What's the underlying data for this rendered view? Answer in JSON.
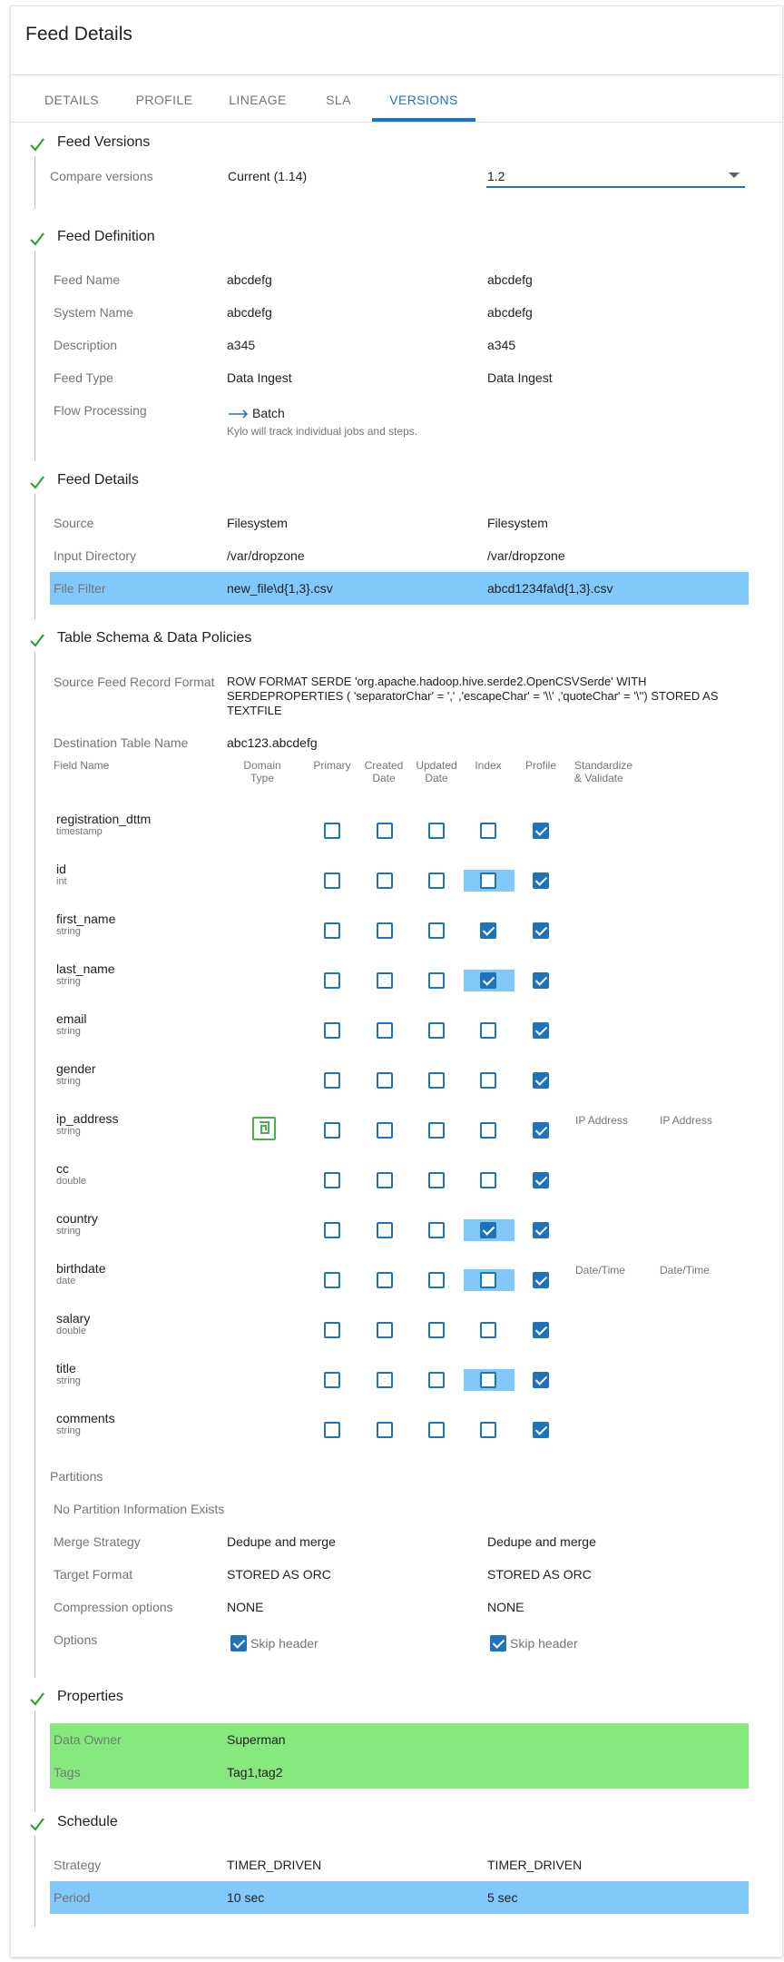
{
  "page": {
    "title": "Feed Details"
  },
  "tabs": [
    {
      "label": "DETAILS",
      "active": false
    },
    {
      "label": "PROFILE",
      "active": false
    },
    {
      "label": "LINEAGE",
      "active": false
    },
    {
      "label": "SLA",
      "active": false
    },
    {
      "label": "VERSIONS",
      "active": true
    }
  ],
  "colors": {
    "accent": "#1e73bb",
    "step_check": "#2e9f3a",
    "diff_highlight": "#81c8fb",
    "added_highlight": "#85e97e"
  },
  "versions": {
    "title": "Feed Versions",
    "compare_label": "Compare versions",
    "current": "Current (1.14)",
    "selected": "1.2"
  },
  "definition": {
    "title": "Feed Definition",
    "rows": [
      {
        "label": "Feed Name",
        "current": "abcdefg",
        "other": "abcdefg"
      },
      {
        "label": "System Name",
        "current": "abcdefg",
        "other": "abcdefg"
      },
      {
        "label": "Description",
        "current": "a345",
        "other": "a345"
      },
      {
        "label": "Feed Type",
        "current": "Data Ingest",
        "other": "Data Ingest"
      }
    ],
    "flow_label": "Flow Processing",
    "flow_value": "Batch",
    "flow_hint": "Kylo will track individual jobs and steps."
  },
  "details": {
    "title": "Feed Details",
    "rows": [
      {
        "label": "Source",
        "current": "Filesystem",
        "other": "Filesystem"
      },
      {
        "label": "Input Directory",
        "current": "/var/dropzone",
        "other": "/var/dropzone"
      },
      {
        "label": "File Filter",
        "current": "new_file\\d{1,3}.csv",
        "other": "abcd1234fa\\d{1,3}.csv"
      }
    ]
  },
  "schema": {
    "title": "Table Schema & Data Policies",
    "source_format_label": "Source Feed Record Format",
    "source_format_lines": [
      "ROW FORMAT SERDE 'org.apache.hadoop.hive.serde2.OpenCSVSerde' WITH",
      "SERDEPROPERTIES ( 'separatorChar' = ',' ,'escapeChar' = '\\\\' ,'quoteChar' = '\\'') STORED AS",
      "TEXTFILE"
    ],
    "dest_label": "Destination Table Name",
    "dest_value": "abc123.abcdefg",
    "headers": {
      "field_name": "Field Name",
      "domain_type": [
        "Domain",
        "Type"
      ],
      "primary": "Primary",
      "created_date": [
        "Created",
        "Date"
      ],
      "updated_date": [
        "Updated",
        "Date"
      ],
      "index": "Index",
      "profile": "Profile",
      "standardize": [
        "Standardize",
        "& Validate"
      ]
    },
    "fields": [
      {
        "name": "registration_dttm",
        "type": "timestamp",
        "index": false,
        "index_hl": false,
        "profile": true
      },
      {
        "name": "id",
        "type": "int",
        "index": false,
        "index_hl": true,
        "profile": true
      },
      {
        "name": "first_name",
        "type": "string",
        "index": true,
        "index_hl": false,
        "profile": true
      },
      {
        "name": "last_name",
        "type": "string",
        "index": true,
        "index_hl": true,
        "profile": true
      },
      {
        "name": "email",
        "type": "string",
        "index": false,
        "index_hl": false,
        "profile": true
      },
      {
        "name": "gender",
        "type": "string",
        "index": false,
        "index_hl": false,
        "profile": true
      },
      {
        "name": "ip_address",
        "type": "string",
        "index": false,
        "index_hl": false,
        "profile": true,
        "domain_icon": true,
        "standardize": "IP Address",
        "validate": "IP Address"
      },
      {
        "name": "cc",
        "type": "double",
        "index": false,
        "index_hl": false,
        "profile": true
      },
      {
        "name": "country",
        "type": "string",
        "index": true,
        "index_hl": true,
        "profile": true
      },
      {
        "name": "birthdate",
        "type": "date",
        "index": false,
        "index_hl": true,
        "profile": true,
        "standardize": "Date/Time",
        "validate": "Date/Time"
      },
      {
        "name": "salary",
        "type": "double",
        "index": false,
        "index_hl": false,
        "profile": true
      },
      {
        "name": "title",
        "type": "string",
        "index": false,
        "index_hl": true,
        "profile": true
      },
      {
        "name": "comments",
        "type": "string",
        "index": false,
        "index_hl": false,
        "profile": true
      }
    ],
    "partitions_label": "Partitions",
    "no_partitions": "No Partition Information Exists",
    "rows": [
      {
        "label": "Merge Strategy",
        "current": "Dedupe and merge",
        "other": "Dedupe and merge"
      },
      {
        "label": "Target Format",
        "current": "STORED AS ORC",
        "other": "STORED AS ORC"
      },
      {
        "label": "Compression options",
        "current": "NONE",
        "other": "NONE"
      }
    ],
    "options_label": "Options",
    "skip_header": "Skip header"
  },
  "properties": {
    "title": "Properties",
    "rows": [
      {
        "label": "Data Owner",
        "current": "Superman"
      },
      {
        "label": "Tags",
        "current": "Tag1,tag2"
      }
    ]
  },
  "schedule": {
    "title": "Schedule",
    "rows": [
      {
        "label": "Strategy",
        "current": "TIMER_DRIVEN",
        "other": "TIMER_DRIVEN"
      },
      {
        "label": "Period",
        "current": "10 sec",
        "other": "5 sec"
      }
    ]
  }
}
